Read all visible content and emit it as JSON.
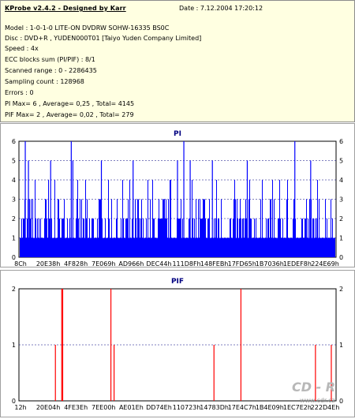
{
  "header": {
    "title": "KProbe v2.4.2 - Designed by Karr",
    "date": "Date : 7.12.2004 17:20:12"
  },
  "info_lines": [
    "Model : 1-0-1-0 LITE-ON DVDRW SOHW-16335 BS0C",
    "Disc : DVD+R , YUDEN000T01 [Taiyo Yuden Company Limited]",
    "Speed : 4x",
    "ECC blocks sum (PI/PIF) : 8/1",
    "Scanned range : 0 - 2286435",
    "Sampling count : 128968",
    "Errors : 0",
    "PI Max= 6 , Average= 0,25 , Total= 4145",
    "PIF Max= 2 , Average= 0,02 , Total= 279"
  ],
  "watermark": {
    "brand": "CD - R",
    "url": "www.cdr.cz"
  },
  "chart_data": [
    {
      "type": "bar",
      "title": "PI",
      "color": "#0000ff",
      "ylim": [
        0,
        6
      ],
      "yticks": [
        "0",
        "1",
        "2",
        "3",
        "4",
        "5",
        "6"
      ],
      "xticks": [
        "8Ch",
        "20E38h",
        "4F828h",
        "7E069h",
        "AD966h",
        "DEC44h",
        "111D8Fh",
        "148FEBh",
        "17FD65h",
        "1B7036h",
        "1EDEF8h",
        "224E69h"
      ],
      "max": 6,
      "average": 0.25,
      "peaks": [
        {
          "pos": 0.02,
          "value": 6
        },
        {
          "pos": 0.165,
          "value": 6
        },
        {
          "pos": 0.52,
          "value": 6
        },
        {
          "pos": 0.87,
          "value": 6
        },
        {
          "pos": 0.03,
          "value": 5
        },
        {
          "pos": 0.1,
          "value": 5
        },
        {
          "pos": 0.17,
          "value": 5
        },
        {
          "pos": 0.36,
          "value": 5
        },
        {
          "pos": 0.5,
          "value": 5
        },
        {
          "pos": 0.72,
          "value": 5
        },
        {
          "pos": 0.92,
          "value": 5
        },
        {
          "pos": 0.54,
          "value": 5
        },
        {
          "pos": 0.26,
          "value": 5
        },
        {
          "pos": 0.61,
          "value": 5
        }
      ]
    },
    {
      "type": "bar",
      "title": "PIF",
      "color": "#ff0000",
      "ylim": [
        0,
        2
      ],
      "yticks": [
        "0",
        "1",
        "2"
      ],
      "xticks": [
        "12h",
        "20E04h",
        "4FE3Eh",
        "7EE00h",
        "AE01Eh",
        "DD74Eh",
        "110723h",
        "14783Dh",
        "17E4C7h",
        "1B4E09h",
        "1EC7E2h",
        "222D4Eh"
      ],
      "max": 2,
      "average": 0.02,
      "bars": [
        {
          "pos": 0.115,
          "value": 1
        },
        {
          "pos": 0.135,
          "value": 2
        },
        {
          "pos": 0.138,
          "value": 2
        },
        {
          "pos": 0.29,
          "value": 2
        },
        {
          "pos": 0.3,
          "value": 1
        },
        {
          "pos": 0.615,
          "value": 1
        },
        {
          "pos": 0.7,
          "value": 2
        },
        {
          "pos": 0.935,
          "value": 1
        },
        {
          "pos": 0.985,
          "value": 1
        }
      ]
    }
  ]
}
